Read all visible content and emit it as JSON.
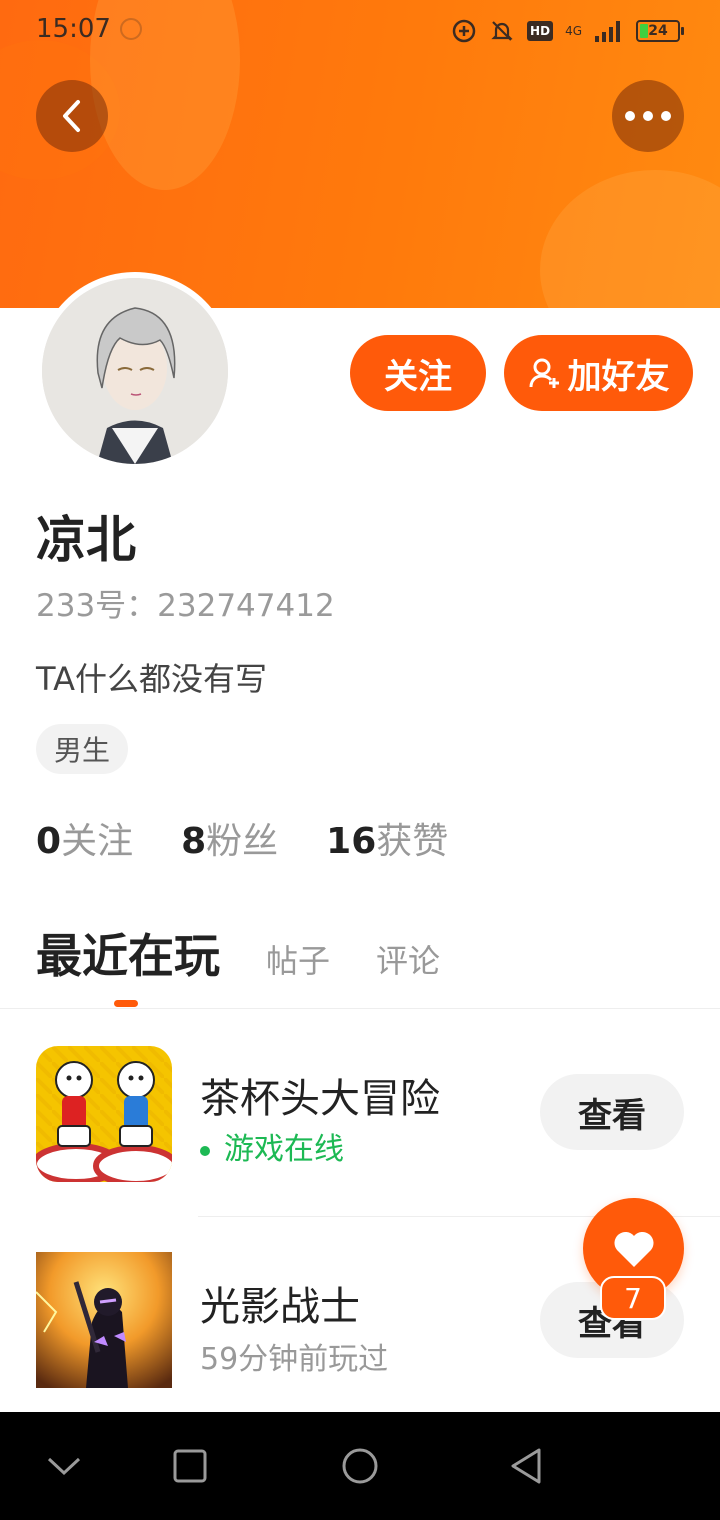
{
  "status_bar": {
    "time": "15:07",
    "network": "4G",
    "hd": "HD",
    "battery": "24"
  },
  "profile": {
    "name": "凉北",
    "id_text": "233号：232747412",
    "bio": "TA什么都没有写",
    "gender": "男生",
    "follow_label": "关注",
    "add_friend_label": "加好友",
    "stats": [
      {
        "num": "0",
        "label": "关注"
      },
      {
        "num": "8",
        "label": "粉丝"
      },
      {
        "num": "16",
        "label": "获赞"
      }
    ]
  },
  "tabs": [
    {
      "label": "最近在玩",
      "active": true
    },
    {
      "label": "帖子",
      "active": false
    },
    {
      "label": "评论",
      "active": false
    }
  ],
  "games": [
    {
      "title": "茶杯头大冒险",
      "status": "游戏在线",
      "online": true,
      "action": "查看"
    },
    {
      "title": "光影战士",
      "status": "59分钟前玩过",
      "online": false,
      "action": "查看"
    }
  ],
  "floating_like": {
    "count": "7"
  },
  "colors": {
    "accent": "#ff5a0a",
    "online": "#1db954"
  }
}
